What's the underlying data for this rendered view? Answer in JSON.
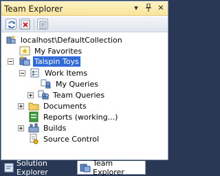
{
  "window": {
    "title": "Team Explorer",
    "controls": {
      "pin": "📌",
      "pin_glyph": "▾",
      "pushpin": "⊥",
      "close": "✕"
    }
  },
  "toolbar": {
    "buttons": [
      {
        "name": "refresh-icon"
      },
      {
        "name": "stop-icon"
      },
      {
        "name": "properties-icon"
      }
    ]
  },
  "tree": {
    "root": "localhost\\DefaultCollection",
    "my_favorites": "My Favorites",
    "project": "Talspin Toys",
    "work_items": "Work Items",
    "my_queries": "My Queries",
    "team_queries": "Team Queries",
    "documents": "Documents",
    "reports": "Reports (working...)",
    "builds": "Builds",
    "source_control": "Source Control"
  },
  "tabs": {
    "solution_explorer": "Solution Explorer",
    "team_explorer": "Team Explorer"
  },
  "colors": {
    "selection": "#336ad9",
    "frame": "#293955",
    "titlebar": "#f9e49b"
  }
}
